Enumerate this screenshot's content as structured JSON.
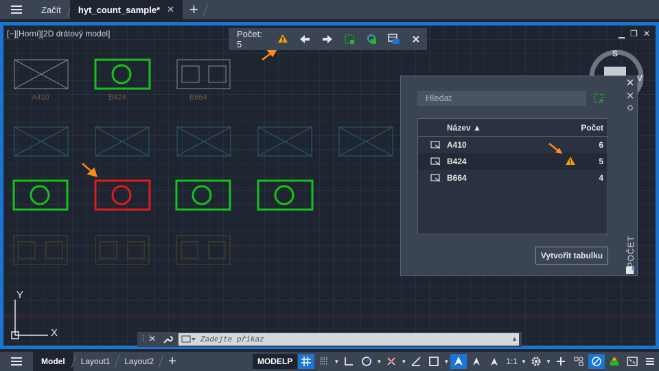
{
  "topbar": {
    "tabs": [
      {
        "label": "Začít"
      },
      {
        "label": "hyt_count_sample*",
        "close": "✕"
      }
    ],
    "new_tab": "+"
  },
  "viewport": {
    "title": "[−][Horní][2D drátový model]",
    "controls": [
      "▁",
      "❐",
      "✕"
    ],
    "viewcube_labels": {
      "s": "S",
      "v": "V"
    }
  },
  "drawing_labels": {
    "a410": "A410",
    "b424": "B424",
    "b664": "B664"
  },
  "count_toolbar": {
    "label": "Počet:",
    "count": "5"
  },
  "palette": {
    "search_placeholder": "Hledat",
    "columns": {
      "name": "Název",
      "count": "Počet"
    },
    "rows": [
      {
        "name": "A410",
        "count": "6"
      },
      {
        "name": "B424",
        "count": "5"
      },
      {
        "name": "B664",
        "count": "4"
      }
    ],
    "create_table": "Vytvořit tabulku",
    "vertical_label": "POČET"
  },
  "ucs": {
    "y": "Y",
    "x": "X"
  },
  "command": {
    "placeholder": "Zadejte příkaz"
  },
  "statusbar": {
    "layouts": [
      "Model",
      "Layout1",
      "Layout2"
    ],
    "new_layout": "+",
    "modelp": "MODELP",
    "scale": "1:1"
  },
  "colors": {
    "accent": "#1976d2",
    "green": "#16c21a",
    "red": "#e01b1b",
    "warning": "#f5a300",
    "arrow": "#ff8c1a"
  }
}
